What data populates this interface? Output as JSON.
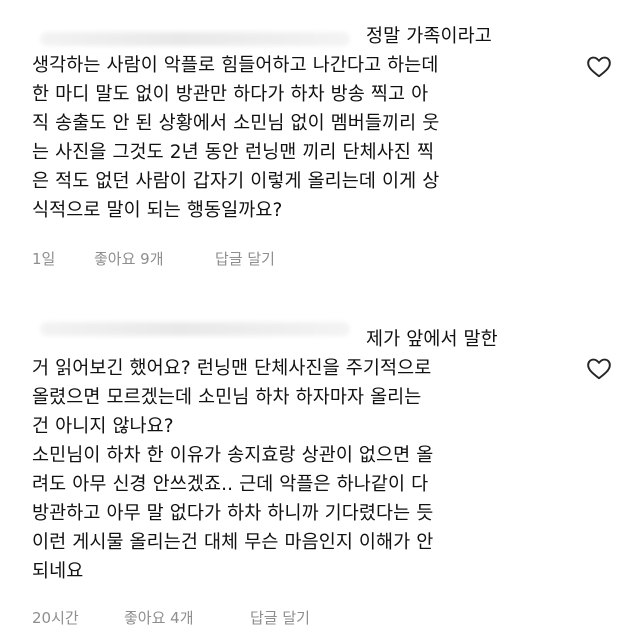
{
  "comments": [
    {
      "lines": [
        "정말 가족이라고",
        "생각하는 사람이 악플로 힘들어하고 나간다고 하는데",
        "한 마디 말도 없이 방관만 하다가 하차 방송 찍고 아",
        "직 송출도 안 된 상황에서 소민님 없이 멤버들끼리 웃",
        "는 사진을 그것도 2년 동안 런닝맨 끼리 단체사진 찍",
        "은 적도 없던 사람이 갑자기 이렇게 올리는데 이게 상",
        "식적으로 말이 되는 행동일까요?"
      ],
      "time": "1일",
      "likes": "좋아요 9개",
      "reply": "답글 달기",
      "like_icon": "heart-outline-icon"
    },
    {
      "lines": [
        "제가 앞에서 말한",
        "거 읽어보긴 했어요? 런닝맨 단체사진을 주기적으로",
        "올렸으면 모르겠는데 소민님 하차 하자마자 올리는",
        "건 아니지 않나요?",
        "소민님이 하차 한 이유가 송지효랑 상관이 없으면 올",
        "려도 아무 신경 안쓰겠죠.. 근데 악플은 하나같이 다",
        "방관하고 아무 말 없다가 하차 하니까 기다렸다는 듯",
        "이런 게시물 올리는건 대체 무슨 마음인지 이해가 안",
        "되네요"
      ],
      "time": "20시간",
      "likes": "좋아요 4개",
      "reply": "답글 달기",
      "like_icon": "heart-outline-icon"
    }
  ],
  "colors": {
    "text": "#111111",
    "meta": "#8e8e8e",
    "icon": "#262626",
    "background": "#ffffff"
  }
}
